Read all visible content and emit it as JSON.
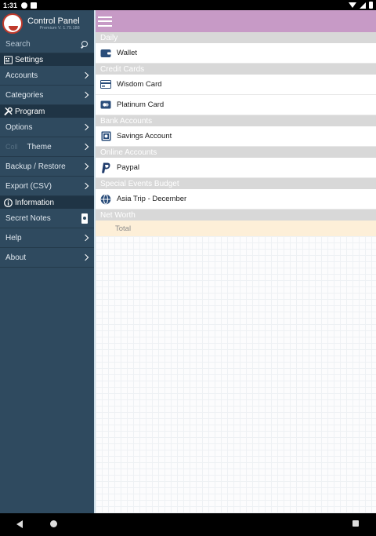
{
  "status_bar": {
    "time": "1:31"
  },
  "sidebar": {
    "title": "Control Panel",
    "version": "Premium V. 1.79.188",
    "search_label": "Search",
    "sections": {
      "settings": "Settings",
      "program": "Program",
      "information": "Information"
    },
    "items": {
      "accounts": "Accounts",
      "categories": "Categories",
      "options": "Options",
      "theme_prefix": "Coll",
      "theme": "Theme",
      "backup": "Backup / Restore",
      "export": "Export (CSV)",
      "secret_notes": "Secret Notes",
      "help": "Help",
      "about": "About"
    }
  },
  "main": {
    "groups": {
      "daily": "Daily",
      "credit_cards": "Credit Cards",
      "bank_accounts": "Bank Accounts",
      "online_accounts": "Online Accounts",
      "special_events": "Special Events Budget",
      "net_worth": "Net Worth"
    },
    "accounts": {
      "wallet": "Wallet",
      "wisdom_card": "Wisdom Card",
      "platinum_card": "Platinum Card",
      "savings_account": "Savings Account",
      "paypal": "Paypal",
      "asia_trip": "Asia Trip - December"
    },
    "total_label": "Total"
  },
  "colors": {
    "sidebar_bg": "#2f4a5f",
    "toolbar": "#c79ac6",
    "group_header": "#d8d8d8",
    "total_bg": "#fdefd8",
    "icon_blue": "#2a4d7a"
  }
}
